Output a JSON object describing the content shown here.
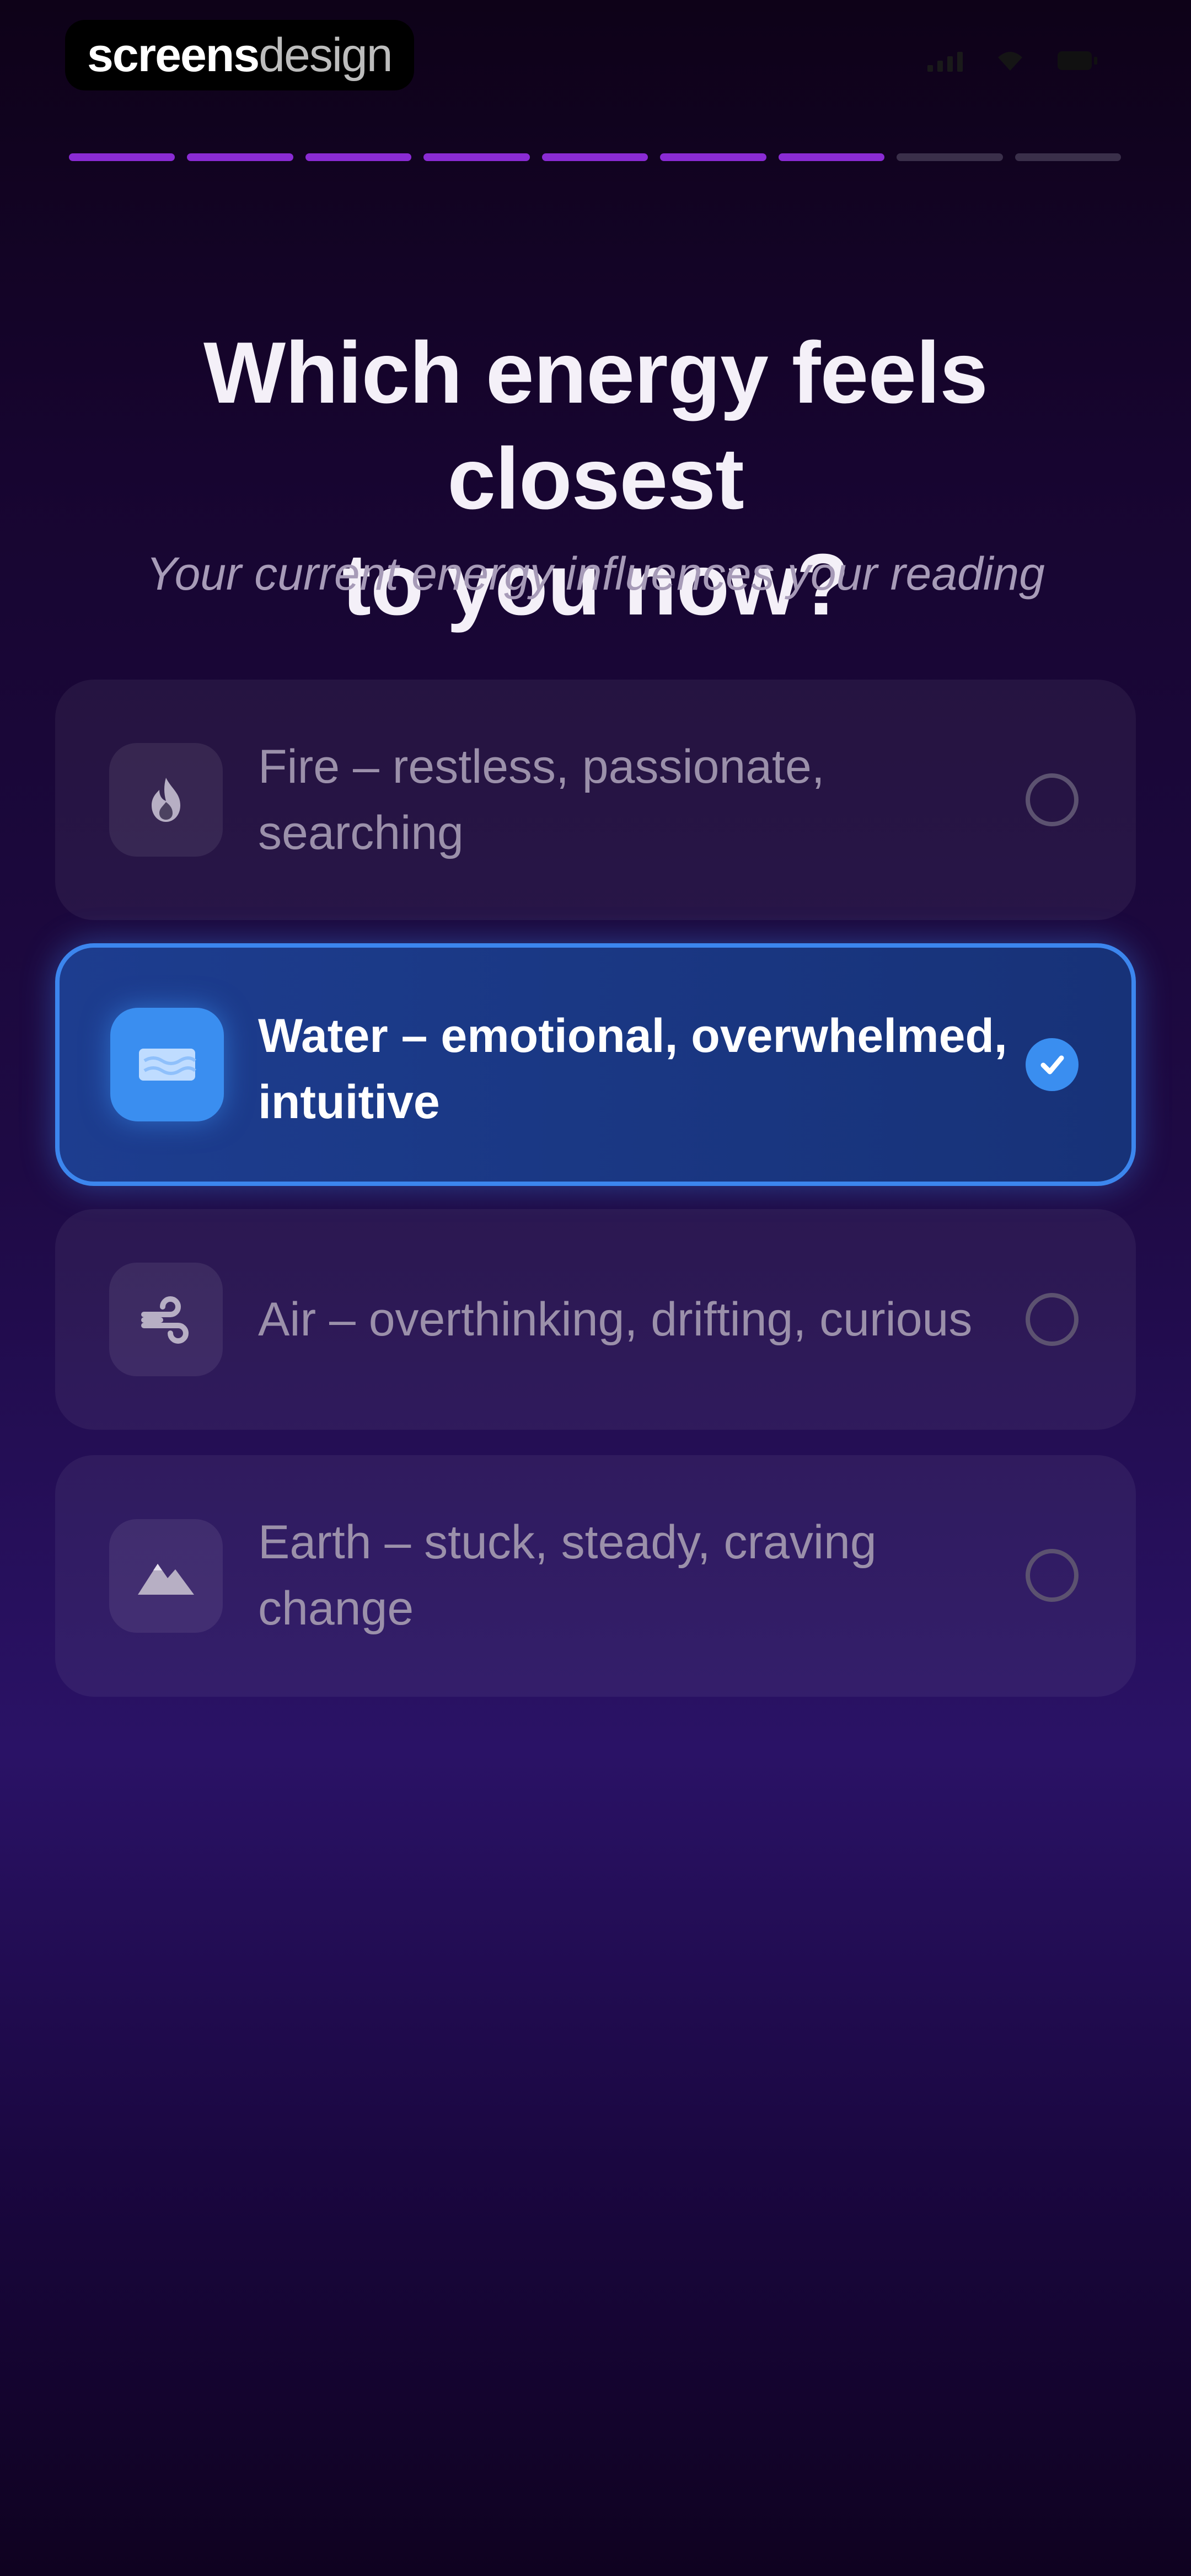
{
  "watermark": {
    "bold": "screens",
    "light": "design"
  },
  "progress": {
    "total_steps": 9,
    "completed_steps": 7
  },
  "question": {
    "title_line1": "Which energy feels closest",
    "title_line2": "to you now?",
    "subtitle": "Your current energy influences your reading"
  },
  "options": [
    {
      "label_line1": "Fire – restless, passionate,",
      "label_line2": "searching",
      "icon": "fire-icon",
      "selected": false
    },
    {
      "label_line1": "Water – emotional, overwhelmed,",
      "label_line2": "intuitive",
      "icon": "water-icon",
      "selected": true
    },
    {
      "label_line1": "Air – overthinking, drifting, curious",
      "label_line2": "",
      "icon": "wind-icon",
      "selected": false
    },
    {
      "label_line1": "Earth – stuck, steady, craving",
      "label_line2": "change",
      "icon": "mountain-icon",
      "selected": false
    }
  ],
  "colors": {
    "accent": "#3a8ef0",
    "progress": "#8a2bd4",
    "background": "#1e0a44"
  }
}
